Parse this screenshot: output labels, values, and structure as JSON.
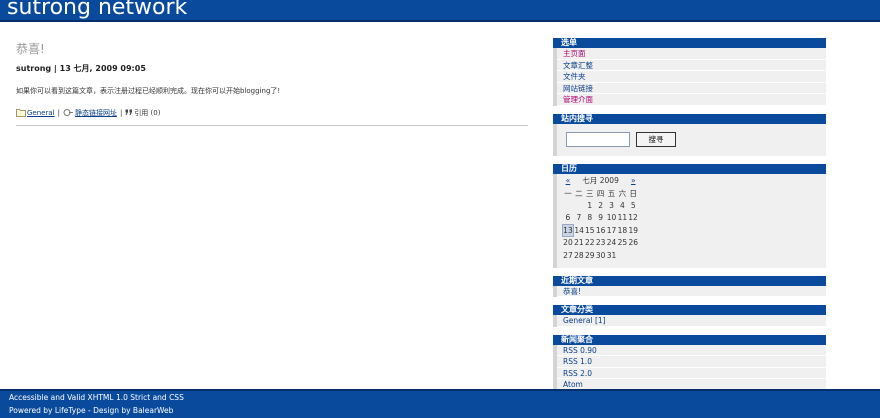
{
  "header": {
    "site_title": "sutrong network"
  },
  "post": {
    "title": "恭喜!",
    "meta": "sutrong | 13 七月, 2009 09:05",
    "body": "如果你可以看到这篇文章，表示注册过程已经顺利完成。现在你可以开始blogging了!",
    "category": "General",
    "permalink": "静态链接网址",
    "sep": "|",
    "trackbacks": "引用 (0)"
  },
  "sidebar": {
    "menu": {
      "title": "选单",
      "items": [
        "主页面",
        "文章汇整",
        "文件夹",
        "网站链接",
        "管理介面"
      ]
    },
    "search": {
      "title": "站内搜寻",
      "button": "搜寻",
      "value": ""
    },
    "calendar": {
      "title": "日历",
      "prev": "«",
      "month": "七月 2009",
      "next": "»",
      "weekdays": [
        "一",
        "二",
        "三",
        "四",
        "五",
        "六",
        "日"
      ],
      "rows": [
        [
          "",
          "",
          "1",
          "2",
          "3",
          "4",
          "5"
        ],
        [
          "6",
          "7",
          "8",
          "9",
          "10",
          "11",
          "12"
        ],
        [
          "13",
          "14",
          "15",
          "16",
          "17",
          "18",
          "19"
        ],
        [
          "20",
          "21",
          "22",
          "23",
          "24",
          "25",
          "26"
        ],
        [
          "27",
          "28",
          "29",
          "30",
          "31",
          "",
          ""
        ]
      ],
      "today": "13"
    },
    "recent": {
      "title": "近期文章",
      "items": [
        "恭喜!"
      ]
    },
    "categories": {
      "title": "文章分类",
      "items": [
        "General [1]"
      ]
    },
    "feeds": {
      "title": "新闻聚合",
      "items": [
        "RSS 0.90",
        "RSS 1.0",
        "RSS 2.0",
        "Atom"
      ]
    }
  },
  "footer": {
    "line1": "Accessible and Valid XHTML 1.0 Strict and CSS",
    "line2": "Powered by LifeType - Design by BalearWeb"
  },
  "colors": {
    "brand": "#0a4a9c",
    "link": "#0b3e8c",
    "menu_link": "#b0006f"
  }
}
